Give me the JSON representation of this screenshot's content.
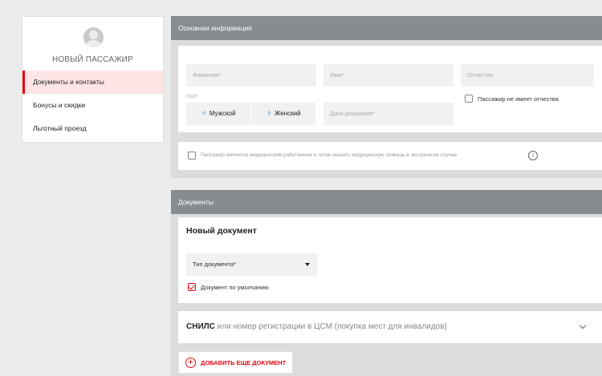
{
  "sidebar": {
    "passenger_title": "НОВЫЙ ПАССАЖИР",
    "items": [
      {
        "label": "Документы и контакты",
        "active": true
      },
      {
        "label": "Бонусы и скидки",
        "active": false
      },
      {
        "label": "Льготный проезд",
        "active": false
      }
    ]
  },
  "basic_info": {
    "header": "Основная информация",
    "surname_placeholder": "Фамилия*",
    "name_placeholder": "Имя*",
    "patronymic_placeholder": "Отчество",
    "gender_label": "Пол*",
    "male_label": "Мужской",
    "female_label": "Женский",
    "birthdate_placeholder": "Дата рождения*",
    "no_patronymic_label": "Пассажир не имеет отчества",
    "medical_worker_label": "Пассажир является медицинским работником и готов оказать медицинскую помощь в экстренном случае"
  },
  "documents": {
    "header": "Документы",
    "new_doc_title": "Новый документ",
    "doc_type_placeholder": "Тип документа*",
    "default_doc_label": "Документ по умолчанию",
    "default_doc_checked": true,
    "snils_bold": "СНИЛС",
    "snils_rest": " или номер регистрации в ЦСМ (покупка мест для инвалидов)",
    "add_button_label": "ДОБАВИТЬ ЕЩЕ ДОКУМЕНТ"
  },
  "colors": {
    "accent": "#e30611",
    "section_header": "#878c91",
    "gender_icon": "#2f80c8"
  }
}
